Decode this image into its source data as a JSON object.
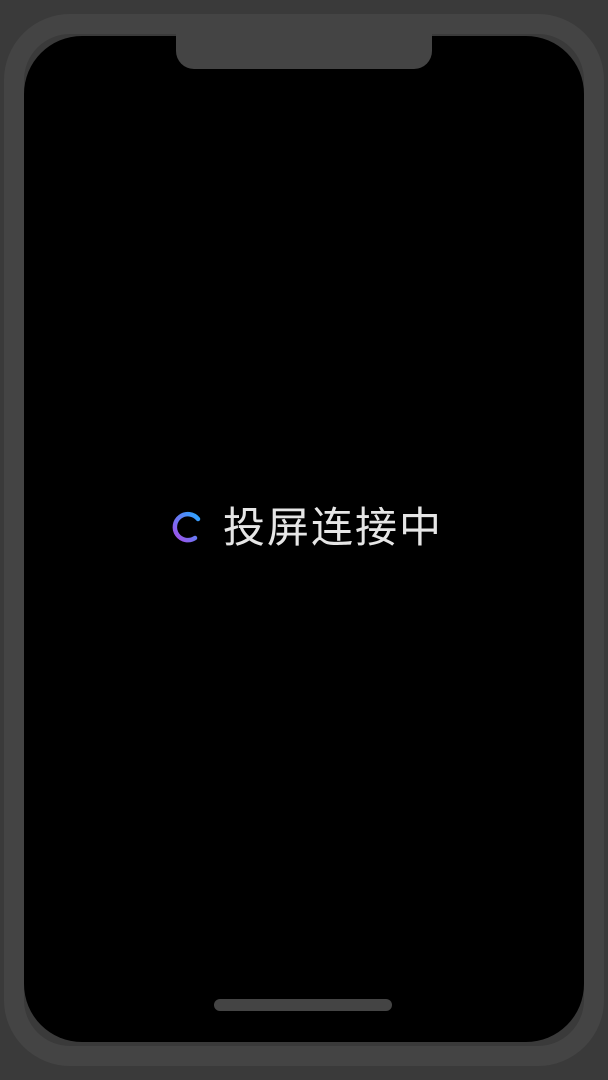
{
  "screen": {
    "status_text": "投屏连接中"
  },
  "icons": {
    "spinner": "loading-spinner-icon"
  },
  "colors": {
    "spinner_start": "#a64ce8",
    "spinner_end": "#2aa6ff",
    "status_text": "#e6e6e6",
    "frame": "#444444",
    "screen": "#000000"
  }
}
